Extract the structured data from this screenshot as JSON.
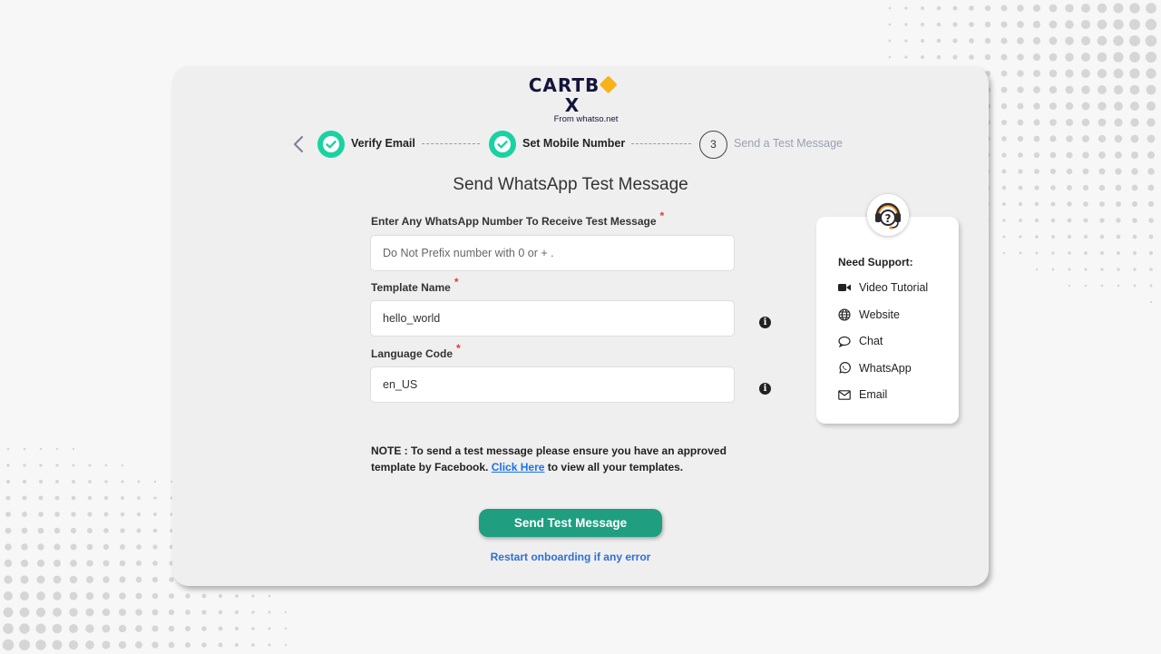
{
  "brand": {
    "name_part1": "CARTB",
    "name_part2": "X",
    "tagline": "From whatso.net"
  },
  "stepper": {
    "steps": [
      {
        "label": "Verify Email",
        "status": "done"
      },
      {
        "label": "Set Mobile Number",
        "status": "done"
      },
      {
        "number": "3",
        "label": "Send a Test Message",
        "status": "current"
      }
    ]
  },
  "page": {
    "title": "Send WhatsApp Test Message"
  },
  "form": {
    "number_label": "Enter Any WhatsApp Number To Receive Test Message",
    "number_placeholder": "Do Not Prefix number with 0 or + .",
    "number_value": "",
    "template_label": "Template Name",
    "template_value": "hello_world",
    "language_label": "Language Code",
    "language_value": "en_US",
    "required_mark": "*",
    "info_glyph": "i"
  },
  "note": {
    "prefix": "NOTE : To send a test message please ensure you have an approved template by Facebook.",
    "link_text": "Click Here",
    "suffix": "to view all your templates."
  },
  "actions": {
    "send_label": "Send Test Message",
    "restart_label": "Restart onboarding if any error"
  },
  "support": {
    "title": "Need Support:",
    "items": [
      {
        "label": "Video Tutorial",
        "icon": "video-icon"
      },
      {
        "label": "Website",
        "icon": "globe-icon"
      },
      {
        "label": "Chat",
        "icon": "chat-icon"
      },
      {
        "label": "WhatsApp",
        "icon": "whatsapp-icon"
      },
      {
        "label": "Email",
        "icon": "envelope-icon"
      }
    ]
  },
  "colors": {
    "accent": "#1f9e80",
    "check": "#18d3a1",
    "link": "#1a73e8",
    "brand_dark": "#14143c",
    "brand_orange": "#f7b21a"
  }
}
